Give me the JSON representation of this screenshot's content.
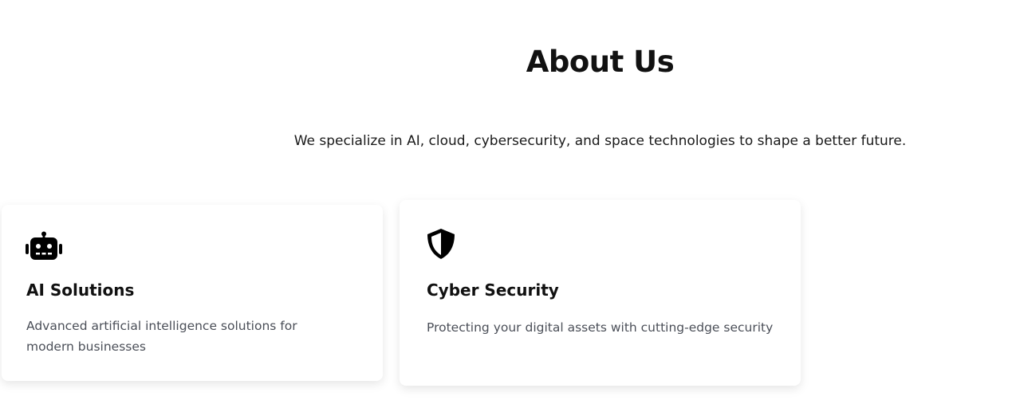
{
  "about": {
    "title": "About Us",
    "description": "We specialize in AI, cloud, cybersecurity, and space technologies to shape a better future."
  },
  "cards": [
    {
      "icon": "robot-icon",
      "title": "AI Solutions",
      "text": "Advanced artificial intelligence solutions for modern businesses"
    },
    {
      "icon": "shield-icon",
      "title": "Cyber Security",
      "text": "Protecting your digital assets with cutting-edge security"
    }
  ],
  "colors": {
    "heading": "#111111",
    "body_text": "#4b4f58",
    "card_background": "#ffffff",
    "page_background": "#ffffff"
  }
}
